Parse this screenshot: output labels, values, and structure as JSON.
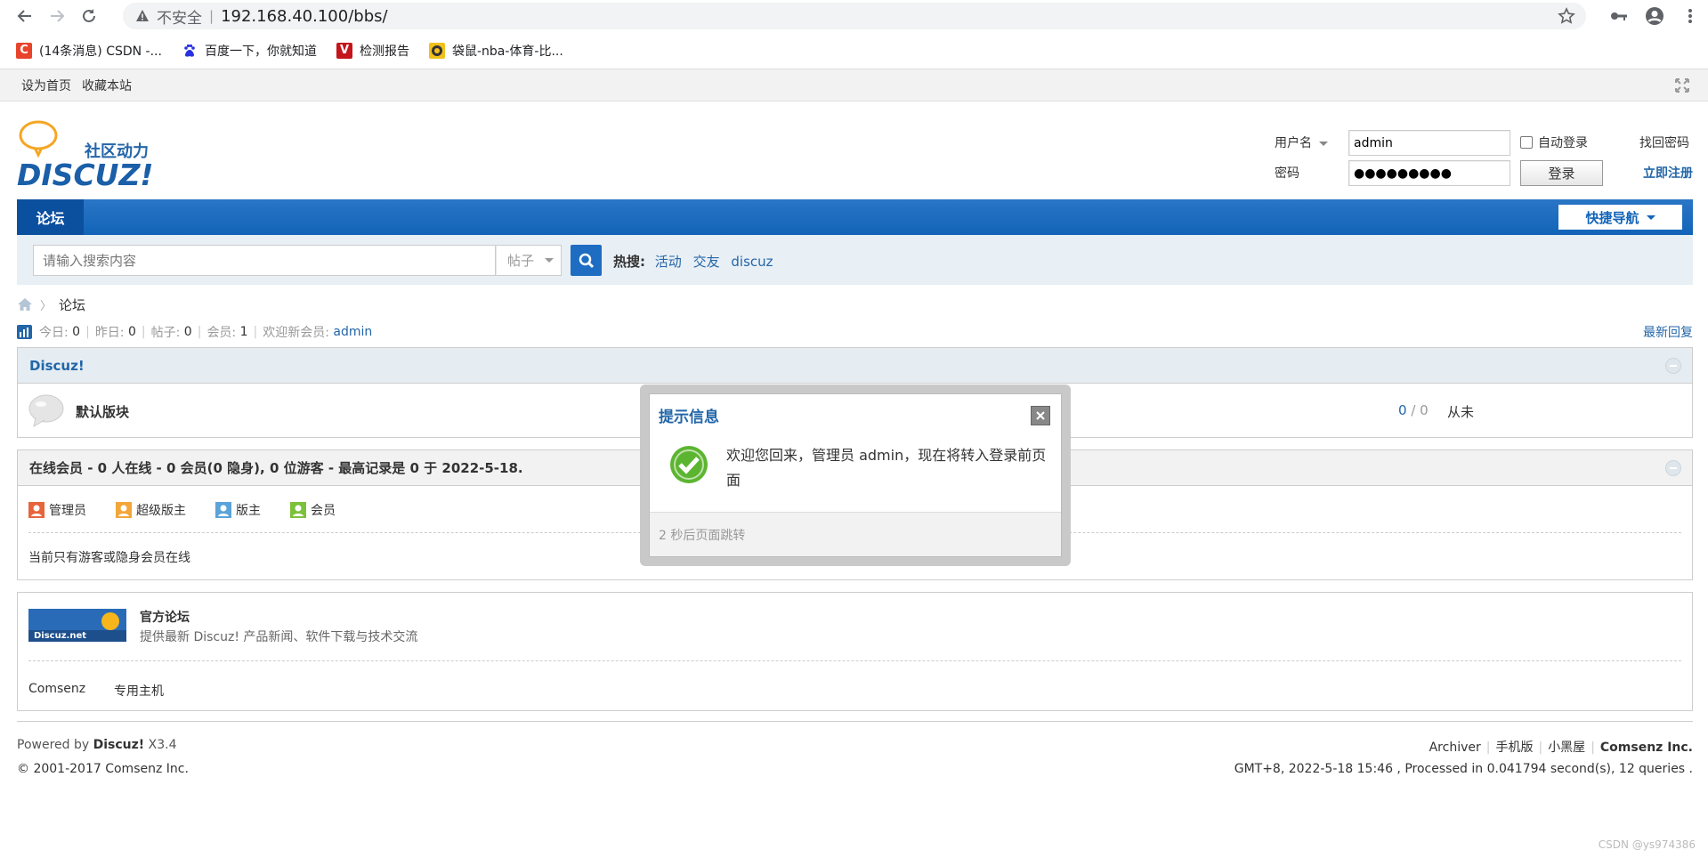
{
  "browser": {
    "security_label": "不安全",
    "separator": "|",
    "url": "192.168.40.100/bbs/",
    "bookmarks": [
      {
        "label": "(14条消息) CSDN -...",
        "color": "#e8442b",
        "glyph": "C"
      },
      {
        "label": "百度一下，你就知道",
        "color": "#2932e1",
        "glyph": "🐾"
      },
      {
        "label": "检测报告",
        "color": "#c3151b",
        "glyph": "V"
      },
      {
        "label": "袋鼠-nba-体育-比...",
        "color": "#f2c01c",
        "glyph": "🦘"
      }
    ]
  },
  "topbar": {
    "set_home": "设为首页",
    "bookmark": "收藏本站"
  },
  "header": {
    "logo_text": "社区动力",
    "logo_brand": "DISCUZ!",
    "login": {
      "username_label": "用户名",
      "username_value": "admin",
      "password_label": "密码",
      "password_value": "●●●●●●●●●",
      "auto_login": "自动登录",
      "login_button": "登录",
      "find_password": "找回密码",
      "register": "立即注册"
    }
  },
  "nav": {
    "current": "论坛",
    "quick_nav": "快捷导航"
  },
  "search": {
    "placeholder": "请输入搜索内容",
    "type": "帖子",
    "hot_label": "热搜:",
    "hot": [
      "活动",
      "交友",
      "discuz"
    ]
  },
  "breadcrumb": {
    "arrow": "〉",
    "current": "论坛"
  },
  "stats": {
    "today_label": "今日:",
    "today": "0",
    "yesterday_label": "昨日:",
    "yesterday": "0",
    "posts_label": "帖子:",
    "posts": "0",
    "members_label": "会员:",
    "members": "1",
    "newest_label": "欢迎新会员:",
    "newest": "admin",
    "latest_reply": "最新回复"
  },
  "forum": {
    "category": "Discuz!",
    "board": {
      "name": "默认版块",
      "threads": "0",
      "posts": "0",
      "slash": "/",
      "last": "从未"
    }
  },
  "online": {
    "heading": "在线会员 - 0 人在线 - 0 会员(0 隐身), 0 位游客 - 最高记录是 0 于 2022-5-18.",
    "legend": [
      "管理员",
      "超级版主",
      "版主",
      "会员"
    ],
    "message": "当前只有游客或隐身会员在线"
  },
  "links": {
    "banner_text": "Discuz.net",
    "title": "官方论坛",
    "desc": "提供最新 Discuz! 产品新闻、软件下载与技术交流",
    "row2": [
      "Comsenz",
      "专用主机"
    ]
  },
  "footer": {
    "powered_prefix": "Powered by",
    "powered_brand": "Discuz!",
    "version": "X3.4",
    "copyright": "© 2001-2017 Comsenz Inc.",
    "links": [
      "Archiver",
      "手机版",
      "小黑屋"
    ],
    "company": "Comsenz Inc.",
    "gmt": "GMT+8, 2022-5-18 15:46 , Processed in 0.041794 second(s), 12 queries ."
  },
  "dialog": {
    "title": "提示信息",
    "message": "欢迎您回来，管理员 admin，现在将转入登录前页面",
    "countdown": "2 秒后页面跳转"
  },
  "watermark": "CSDN @ys974386",
  "colors": {
    "brand_blue": "#1264b8",
    "link": "#2366a8",
    "ok_green": "#5cb531"
  }
}
